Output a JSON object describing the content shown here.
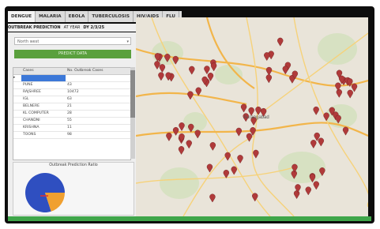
{
  "tabs": [
    {
      "label": "DENGUE",
      "active": true
    },
    {
      "label": "MALARIA",
      "active": false
    },
    {
      "label": "EBOLA",
      "active": false
    },
    {
      "label": "TUBERCULOSIS",
      "active": false
    },
    {
      "label": "HIV/AIDS",
      "active": false
    },
    {
      "label": "FLU",
      "active": false
    }
  ],
  "subbar": {
    "title": "OUTBREAK PREDICTION",
    "sep": "AT YEAR",
    "year": "DY 2/3/25"
  },
  "panel": {
    "select_value": "North west",
    "predict_button": "PREDICT DATA"
  },
  "table": {
    "headers": [
      "Cases",
      "No. Outbreak Cases"
    ],
    "rows": [
      {
        "name": "",
        "value": ""
      },
      {
        "name": "PUNE",
        "value": "43"
      },
      {
        "name": "RAJSHREE",
        "value": "10472"
      },
      {
        "name": "IGL",
        "value": "63"
      },
      {
        "name": "BELNERE",
        "value": "21"
      },
      {
        "name": "KL COMPUTER",
        "value": "28"
      },
      {
        "name": "CHANDNI",
        "value": "55"
      },
      {
        "name": "KRISHNA",
        "value": "11"
      },
      {
        "name": "TOONS",
        "value": "98"
      }
    ]
  },
  "pie": {
    "title": "Outbreak Prediction Ratio",
    "colors": {
      "major": "#2f4fc0",
      "minor": "#f0a030",
      "accent": "#e03030"
    },
    "minor_share": 0.2
  },
  "map": {
    "city_label": "Aurangabad",
    "marker_color": "#b03a3a",
    "marker_icon": "outbreak-pin-icon"
  },
  "colors": {
    "green": "#3fa64a",
    "tabbar": "#dcdcdc"
  }
}
